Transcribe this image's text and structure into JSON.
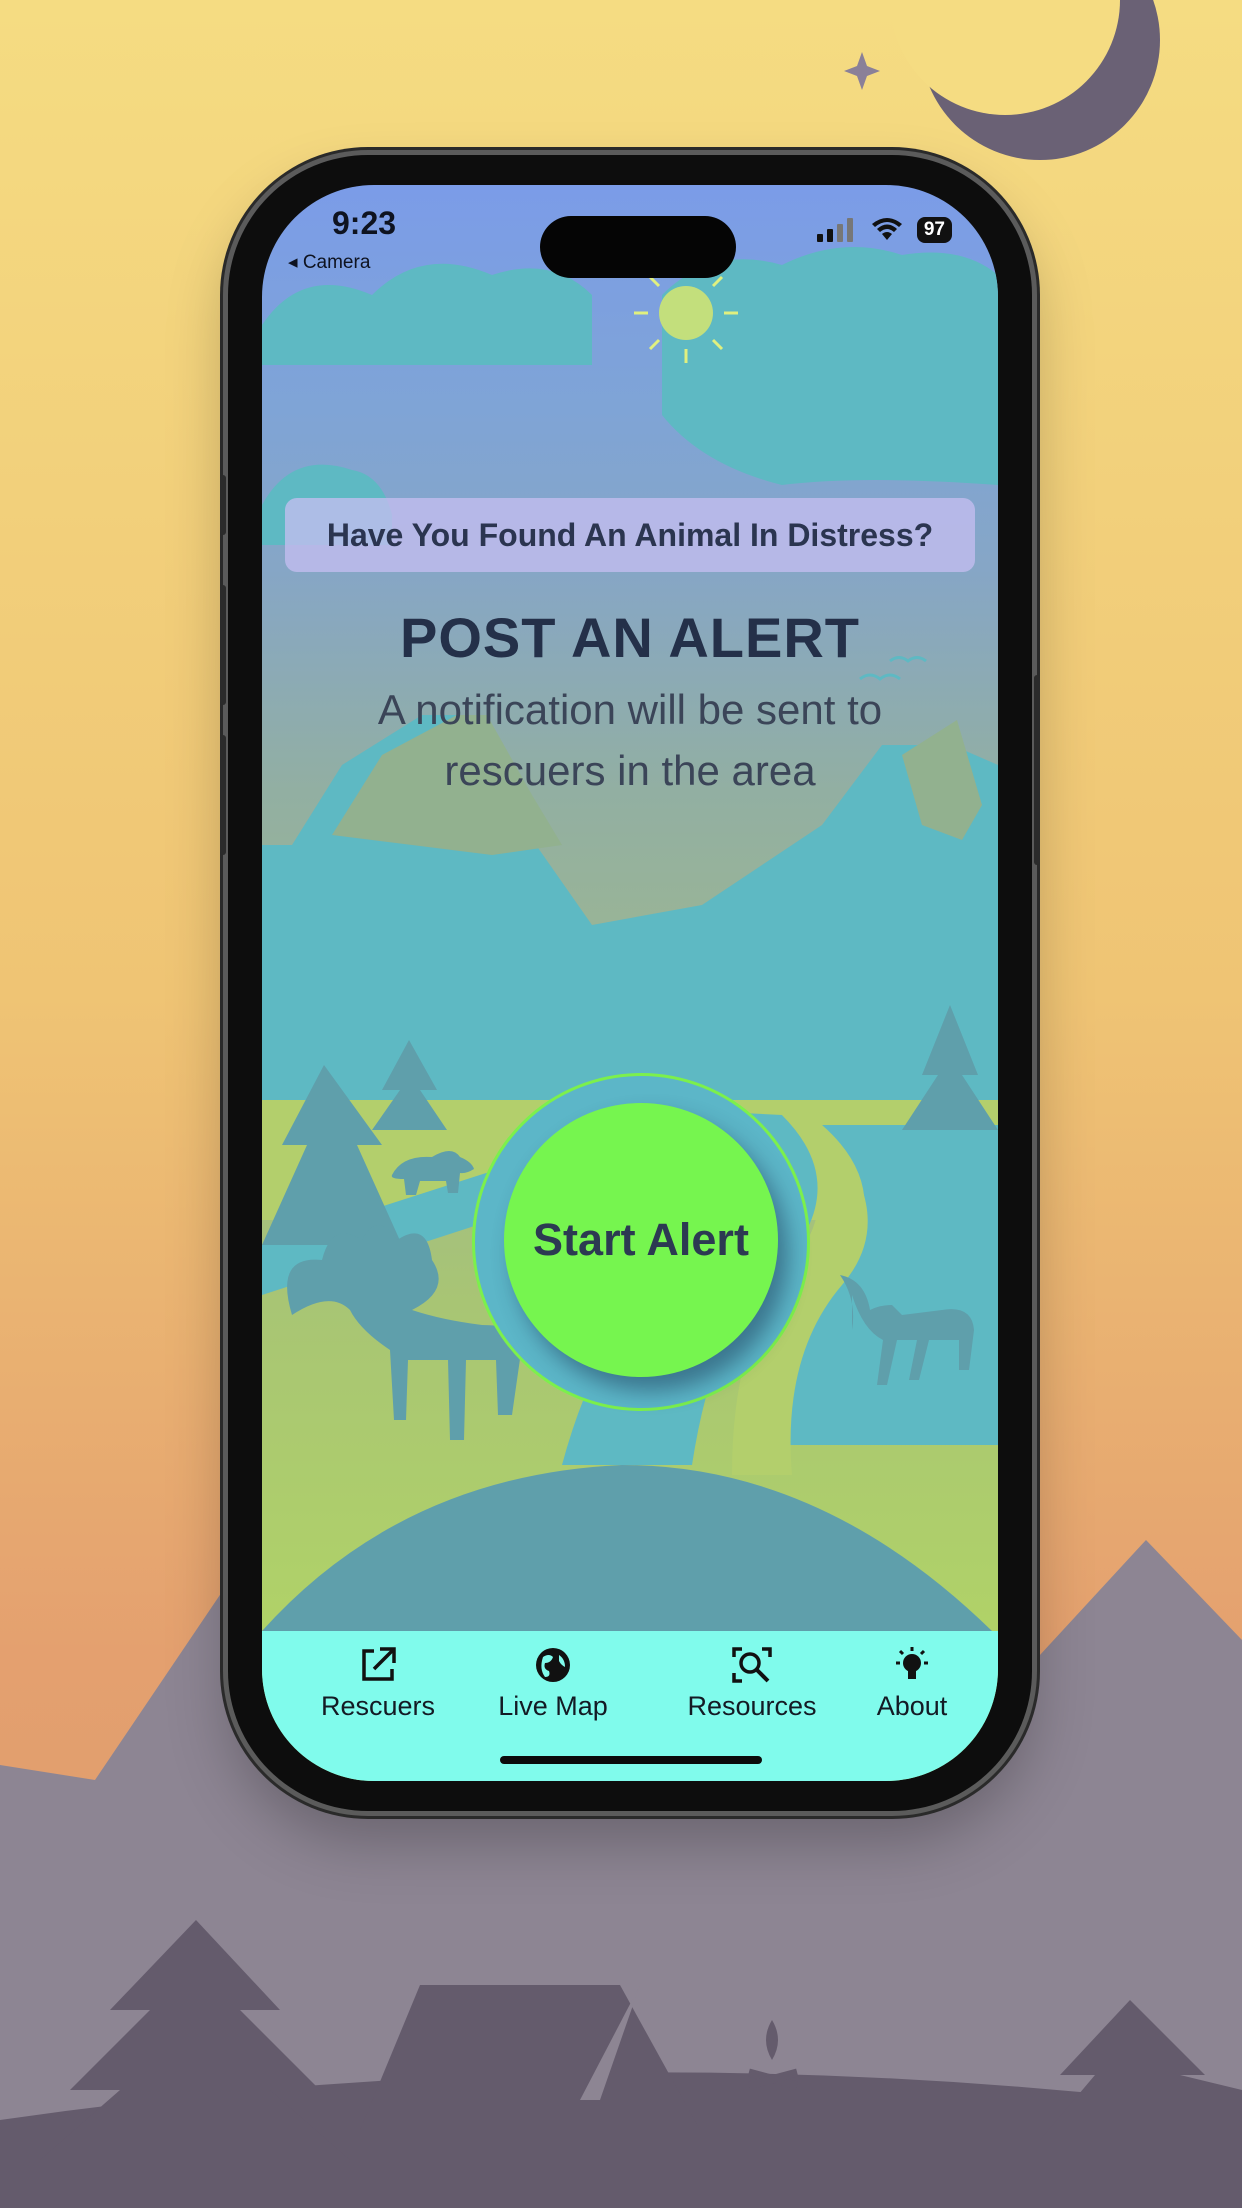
{
  "status_bar": {
    "time": "9:23",
    "back_label": "◂ Camera",
    "battery": "97"
  },
  "banner": {
    "text": "Have You Found An Animal In Distress?"
  },
  "hero": {
    "title": "POST AN ALERT",
    "subtitle_line1": "A notification will be sent to",
    "subtitle_line2": "rescuers in the area"
  },
  "alert_button": {
    "label": "Start Alert"
  },
  "tabs": [
    {
      "label": "Rescuers",
      "icon": "external-link-icon"
    },
    {
      "label": "Live Map",
      "icon": "globe-icon"
    },
    {
      "label": "Resources",
      "icon": "search-icon"
    },
    {
      "label": "About",
      "icon": "lightbulb-icon"
    }
  ],
  "colors": {
    "accent_green": "#76f54f",
    "tab_bar": "#80fbec",
    "text_dark": "#243049"
  }
}
